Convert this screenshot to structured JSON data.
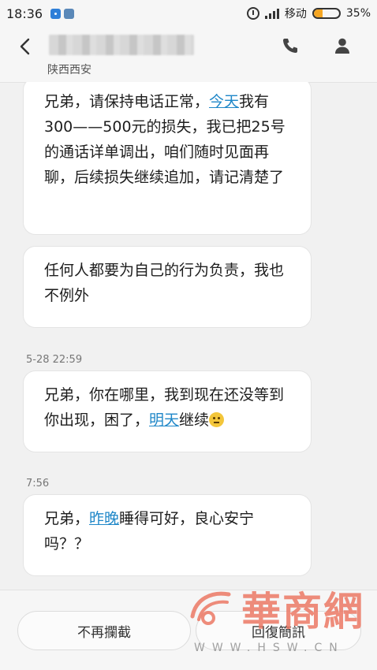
{
  "status_bar": {
    "time": "18:36",
    "carrier": "移动",
    "battery_percent": "35%",
    "battery_level": 0.35
  },
  "header": {
    "location": "陕西西安"
  },
  "messages": [
    {
      "before": "兄弟，请保持电话正常，",
      "link": "今天",
      "after": "我有300——500元的损失，我已把25号的通话详单调出，咱们随时见面再聊，后续损失继续追加，请记清楚了"
    },
    {
      "text": "任何人都要为自己的行为负责，我也不例外"
    },
    {
      "timestamp": "5-28 22:59",
      "before": "兄弟，你在哪里，我到现在还没等到你出现，困了，",
      "link": "明天",
      "after": "继续",
      "emoji": "confused-face"
    },
    {
      "timestamp": "7:56",
      "before": "兄弟，",
      "link": "昨晚",
      "after": "睡得可好，良心安宁吗？？"
    }
  ],
  "bottom_bar": {
    "block_label": "不再攔截",
    "reply_label": "回復簡訊"
  },
  "watermark": {
    "title": "華商網",
    "url": "WWW.HSW.CN"
  }
}
